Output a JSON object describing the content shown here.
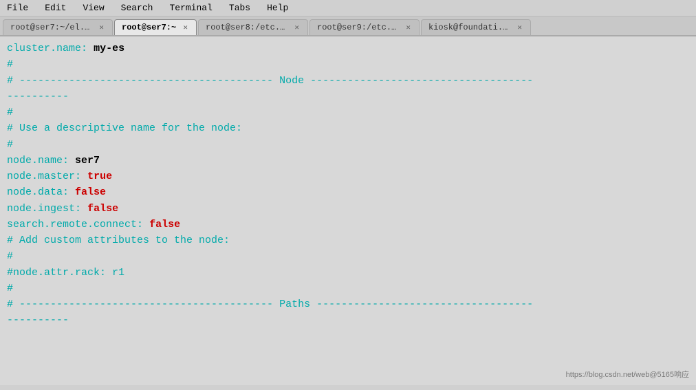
{
  "menu": {
    "items": [
      "File",
      "Edit",
      "View",
      "Search",
      "Terminal",
      "Tabs",
      "Help"
    ]
  },
  "tabs": [
    {
      "id": "tab1",
      "label": "root@ser7:~/el...",
      "active": false
    },
    {
      "id": "tab2",
      "label": "root@ser7:~",
      "active": true
    },
    {
      "id": "tab3",
      "label": "root@ser8:/etc...",
      "active": false
    },
    {
      "id": "tab4",
      "label": "root@ser9:/etc...",
      "active": false
    },
    {
      "id": "tab5",
      "label": "kiosk@foundati...",
      "active": false
    }
  ],
  "lines": [
    {
      "id": "l1",
      "text": "cluster.name: my-es"
    },
    {
      "id": "l2",
      "text": "#"
    },
    {
      "id": "l3",
      "text": "# ----------------------------------------- Node ------------------------------------"
    },
    {
      "id": "l4",
      "text": "----------"
    },
    {
      "id": "l5",
      "text": "#"
    },
    {
      "id": "l6",
      "text": "# Use a descriptive name for the node:"
    },
    {
      "id": "l7",
      "text": "#"
    },
    {
      "id": "l8",
      "text": "node.name: ser7"
    },
    {
      "id": "l9",
      "text": "node.master: true"
    },
    {
      "id": "l10",
      "text": "node.data: false"
    },
    {
      "id": "l11",
      "text": "node.ingest: false"
    },
    {
      "id": "l12",
      "text": "search.remote.connect: false"
    },
    {
      "id": "l13",
      "text": "# Add custom attributes to the node:"
    },
    {
      "id": "l14",
      "text": "#"
    },
    {
      "id": "l15",
      "text": "#node.attr.rack: r1"
    },
    {
      "id": "l16",
      "text": "#"
    },
    {
      "id": "l17",
      "text": "# ----------------------------------------- Paths -----------------------------------"
    },
    {
      "id": "l18",
      "text": "----------"
    }
  ],
  "watermark": "https://blog.csdn.net/web@5165响应"
}
